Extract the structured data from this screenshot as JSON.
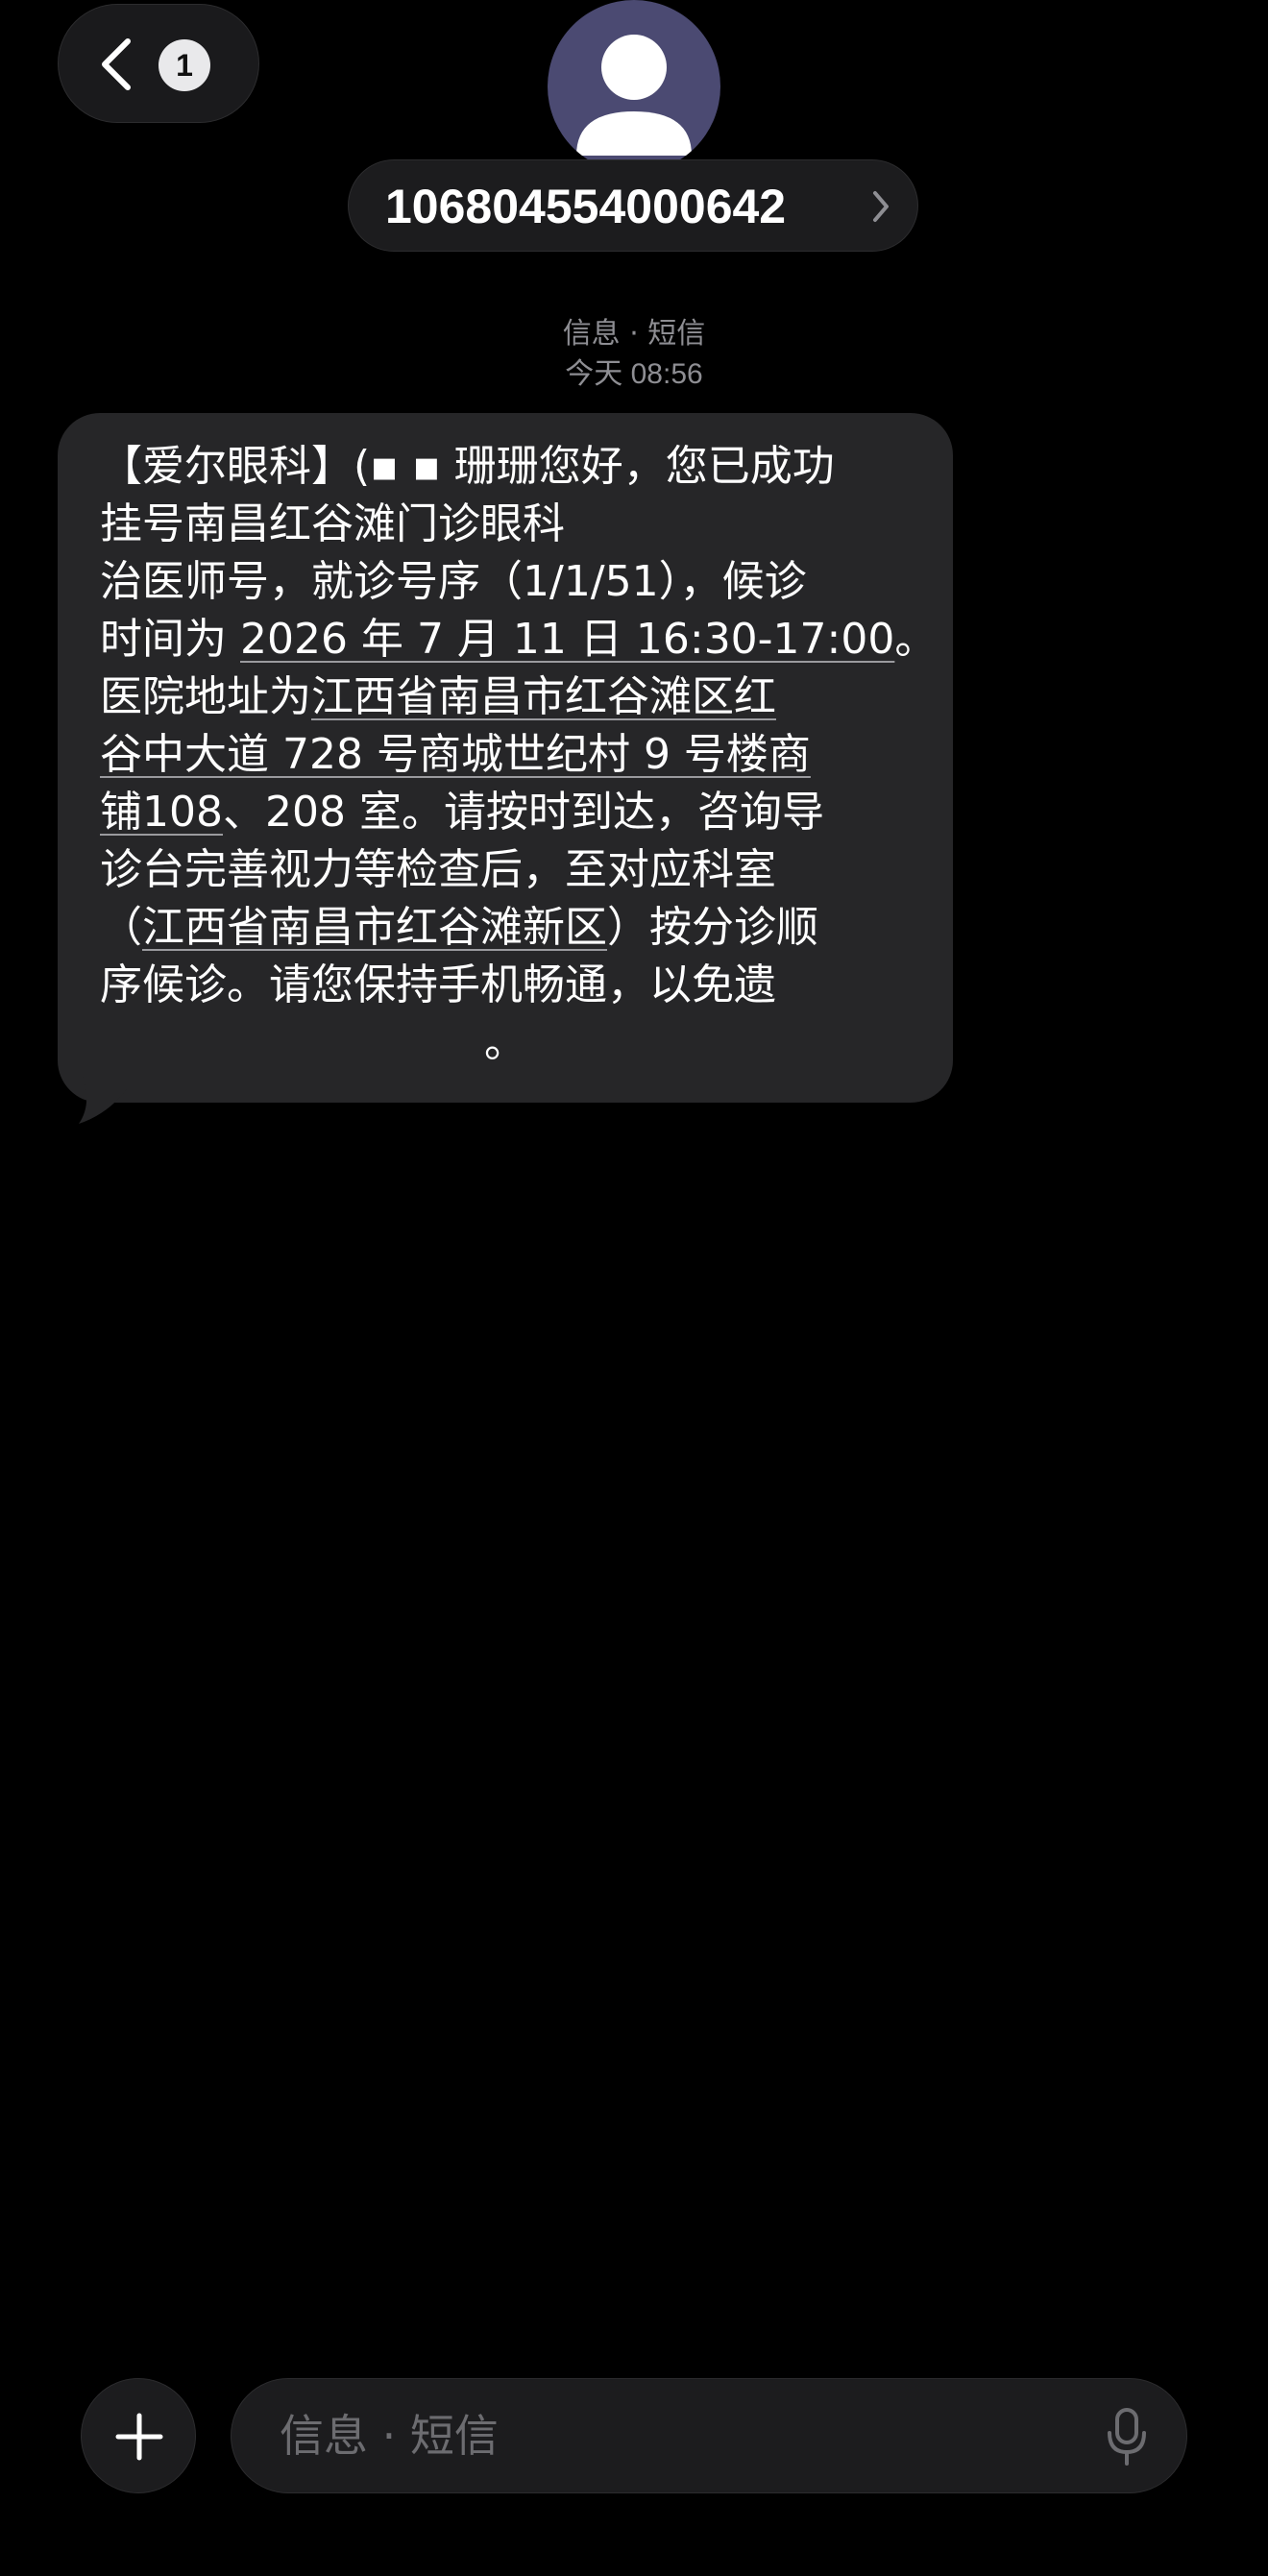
{
  "header": {
    "back_badge": "1",
    "contact_number": "106804554000642"
  },
  "thread": {
    "service_label": "信息 · 短信",
    "timestamp": "今天 08:56"
  },
  "message": {
    "lines": [
      "【爱尔眼科】(▪ ▪ 珊珊您好，您已成功",
      "挂号南昌红谷滩门诊眼科",
      "治医师号，就诊号序（1/1/51），候诊",
      "时间为 ",
      "医院地址为",
      "谷中大道 728 号商城世纪村 9 号楼商",
      "铺108",
      "、208 室。请按时到达，咨询导",
      "诊台完善视力等检查后，至对应科室",
      "（",
      "江西省南昌市红谷滩新区",
      "）按分诊顺",
      "序候诊。请您保持手机畅通，以免遗",
      "。"
    ],
    "datetime_link": "2026 年 7 月 11 日 16:30-17:00",
    "datetime_suffix": "。",
    "address_link_part1": "江西省南昌市红谷滩区红"
  },
  "composer": {
    "placeholder": "信息 · 短信"
  }
}
